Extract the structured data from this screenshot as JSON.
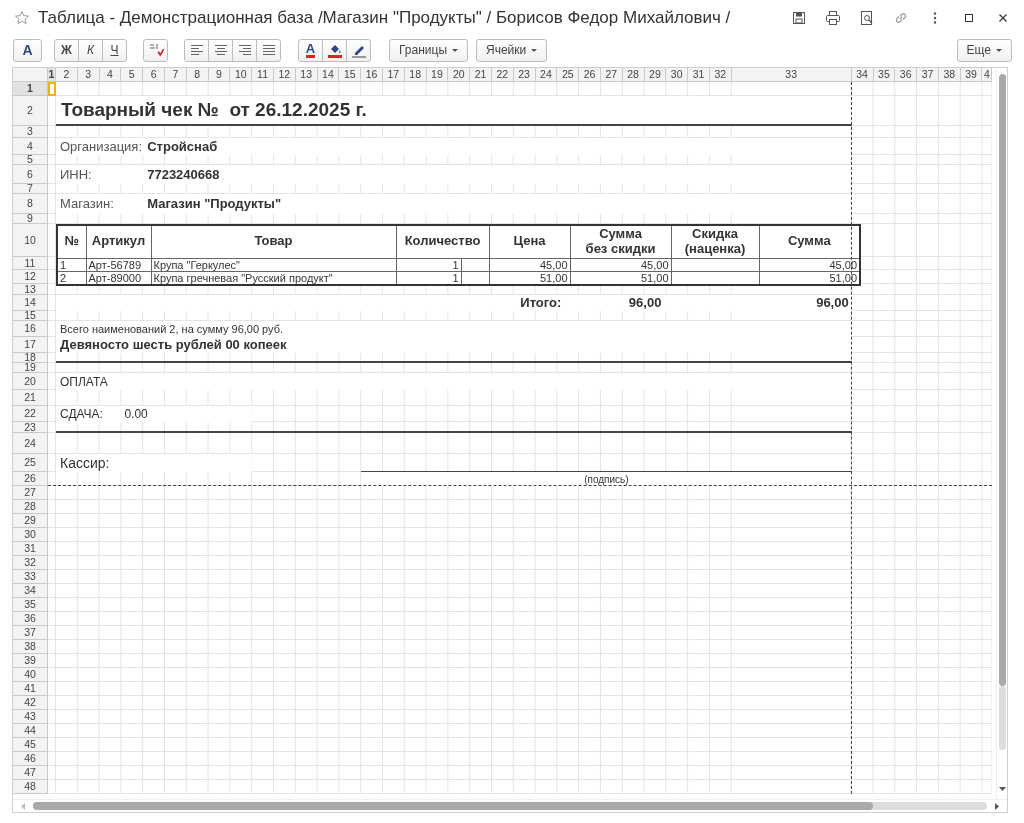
{
  "window": {
    "title": "Таблица - Демонстрационная база /Магазин \"Продукты\" / Борисов Федор Михайлович /"
  },
  "toolbar": {
    "groups": [
      [
        {
          "kind": "font",
          "label": "A"
        }
      ],
      [
        {
          "kind": "bold",
          "label": "Ж"
        },
        {
          "kind": "italic",
          "label": "К"
        },
        {
          "kind": "underline",
          "label": "Ч"
        }
      ],
      [
        {
          "kind": "spellcheck"
        }
      ],
      [
        {
          "kind": "align-left"
        },
        {
          "kind": "align-center"
        },
        {
          "kind": "align-right"
        },
        {
          "kind": "justify"
        }
      ],
      [
        {
          "kind": "text-color",
          "label": "A"
        },
        {
          "kind": "fill-color"
        },
        {
          "kind": "highlight"
        }
      ]
    ],
    "menus": [
      {
        "label": "Границы"
      },
      {
        "label": "Ячейки"
      }
    ],
    "more": {
      "label": "Еще"
    }
  },
  "sheet": {
    "column_headers": [
      {
        "label": "1",
        "selected": true
      },
      {
        "label": "2",
        "selected": false
      },
      {
        "label": "3",
        "selected": false
      },
      {
        "label": "4",
        "selected": false
      },
      {
        "label": "5",
        "selected": false
      },
      {
        "label": "6",
        "selected": false
      },
      {
        "label": "7",
        "selected": false
      },
      {
        "label": "8",
        "selected": false
      },
      {
        "label": "9",
        "selected": false
      },
      {
        "label": "10",
        "selected": false
      },
      {
        "label": "11",
        "selected": false
      },
      {
        "label": "12",
        "selected": false
      },
      {
        "label": "13",
        "selected": false
      },
      {
        "label": "14",
        "selected": false
      },
      {
        "label": "15",
        "selected": false
      },
      {
        "label": "16",
        "selected": false
      },
      {
        "label": "17",
        "selected": false
      },
      {
        "label": "18",
        "selected": false
      },
      {
        "label": "19",
        "selected": false
      },
      {
        "label": "20",
        "selected": false
      },
      {
        "label": "21",
        "selected": false
      },
      {
        "label": "22",
        "selected": false
      },
      {
        "label": "23",
        "selected": false
      },
      {
        "label": "24",
        "selected": false
      },
      {
        "label": "25",
        "selected": false
      },
      {
        "label": "26",
        "selected": false
      },
      {
        "label": "27",
        "selected": false
      },
      {
        "label": "28",
        "selected": false
      },
      {
        "label": "29",
        "selected": false
      },
      {
        "label": "30",
        "selected": false
      },
      {
        "label": "31",
        "selected": false
      },
      {
        "label": "32",
        "selected": false
      },
      {
        "label": "33",
        "selected": false
      },
      {
        "label": "34",
        "selected": false
      },
      {
        "label": "35",
        "selected": false
      },
      {
        "label": "36",
        "selected": false
      },
      {
        "label": "37",
        "selected": false
      },
      {
        "label": "38",
        "selected": false
      },
      {
        "label": "39",
        "selected": false
      },
      {
        "label": "4",
        "selected": false
      }
    ],
    "row_headers": [
      {
        "label": "1",
        "selected": true
      },
      {
        "label": "2",
        "selected": false
      },
      {
        "label": "3",
        "selected": false
      },
      {
        "label": "4",
        "selected": false
      },
      {
        "label": "5",
        "selected": false
      },
      {
        "label": "6",
        "selected": false
      },
      {
        "label": "7",
        "selected": false
      },
      {
        "label": "8",
        "selected": false
      },
      {
        "label": "9",
        "selected": false
      },
      {
        "label": "10",
        "selected": false
      },
      {
        "label": "11",
        "selected": false
      },
      {
        "label": "12",
        "selected": false
      },
      {
        "label": "13",
        "selected": false
      },
      {
        "label": "14",
        "selected": false
      },
      {
        "label": "15",
        "selected": false
      },
      {
        "label": "16",
        "selected": false
      },
      {
        "label": "17",
        "selected": false
      },
      {
        "label": "18",
        "selected": false
      },
      {
        "label": "19",
        "selected": false
      },
      {
        "label": "20",
        "selected": false
      },
      {
        "label": "21",
        "selected": false
      },
      {
        "label": "22",
        "selected": false
      },
      {
        "label": "23",
        "selected": false
      },
      {
        "label": "24",
        "selected": false
      },
      {
        "label": "25",
        "selected": false
      },
      {
        "label": "26",
        "selected": false
      },
      {
        "label": "27",
        "selected": false
      },
      {
        "label": "28",
        "selected": false
      },
      {
        "label": "29",
        "selected": false
      },
      {
        "label": "30",
        "selected": false
      },
      {
        "label": "31",
        "selected": false
      },
      {
        "label": "32",
        "selected": false
      },
      {
        "label": "33",
        "selected": false
      },
      {
        "label": "34",
        "selected": false
      },
      {
        "label": "35",
        "selected": false
      },
      {
        "label": "36",
        "selected": false
      },
      {
        "label": "37",
        "selected": false
      },
      {
        "label": "38",
        "selected": false
      },
      {
        "label": "39",
        "selected": false
      },
      {
        "label": "40",
        "selected": false
      },
      {
        "label": "41",
        "selected": false
      },
      {
        "label": "42",
        "selected": false
      },
      {
        "label": "43",
        "selected": false
      },
      {
        "label": "44",
        "selected": false
      },
      {
        "label": "45",
        "selected": false
      },
      {
        "label": "46",
        "selected": false
      },
      {
        "label": "47",
        "selected": false
      },
      {
        "label": "48",
        "selected": false
      }
    ]
  },
  "document": {
    "title": "Товарный чек №  от 26.12.2025 г.",
    "details": [
      {
        "label": "Организация:",
        "value": "Стройснаб"
      },
      {
        "label": "ИНН:",
        "value": "7723240668"
      },
      {
        "label": "Магазин:",
        "value": "Магазин \"Продукты\""
      }
    ],
    "table": {
      "columns": [
        "№",
        "Артикул",
        "Товар",
        "Количество",
        "Цена",
        "Сумма\nбез скидки",
        "Скидка\n(наценка)",
        "Сумма"
      ],
      "rows": [
        {
          "number": "1",
          "article": "Арт-56789",
          "product": "Крупа \"Геркулес\"",
          "quantity": "1",
          "price": "45,00",
          "subtotal": "45,00",
          "total": "45,00"
        },
        {
          "number": "2",
          "article": "Арт-89000",
          "product": "Крупа гречневая \"Русский продукт\"",
          "quantity": "1",
          "price": "51,00",
          "subtotal": "51,00",
          "total": "51,00"
        }
      ]
    },
    "totals": {
      "label": "Итого:",
      "subtotal": "96,00",
      "total": "96,00"
    },
    "summary": "Всего наименований 2, на сумму 96,00 руб.",
    "amount_in_words": "Девяносто шесть рублей 00 копеек",
    "payment_label": "ОПЛАТА",
    "change": {
      "label": "СДАЧА:",
      "value": "0.00"
    },
    "cashier_label": "Кассир:",
    "signature_caption": "(подпись)"
  }
}
